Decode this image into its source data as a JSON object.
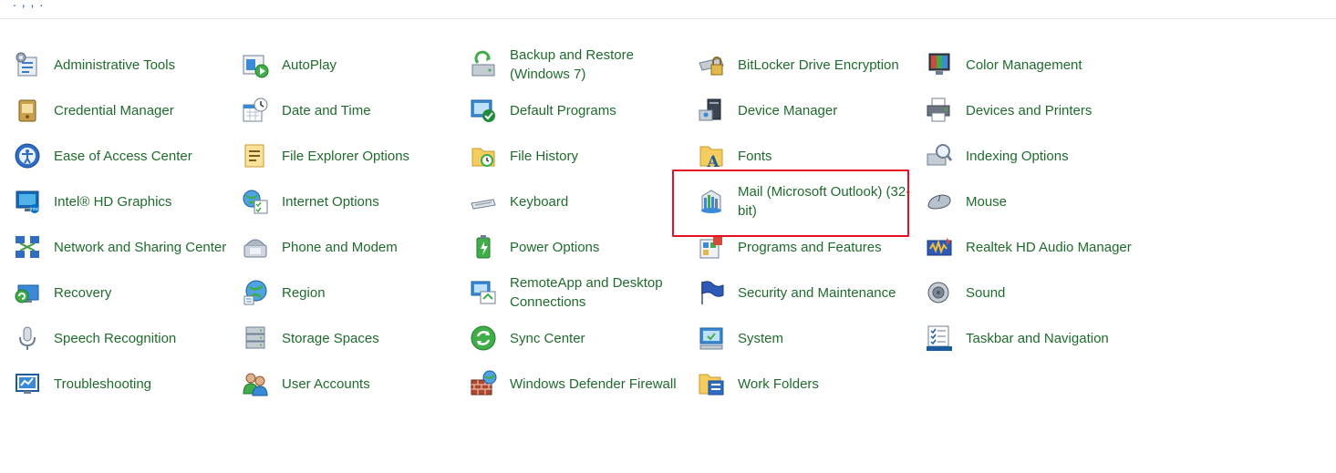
{
  "colors": {
    "link_green": "#1f6b2d",
    "highlight_red": "#e81123",
    "divider": "#e6e6e6"
  },
  "columns": [
    {
      "items": [
        {
          "label": "Administrative Tools",
          "icon": "admin-tools-icon"
        },
        {
          "label": "Credential Manager",
          "icon": "credential-manager-icon"
        },
        {
          "label": "Ease of Access Center",
          "icon": "ease-of-access-icon"
        },
        {
          "label": "Intel® HD Graphics",
          "icon": "intel-graphics-icon"
        },
        {
          "label": "Network and Sharing Center",
          "icon": "network-icon"
        },
        {
          "label": "Recovery",
          "icon": "recovery-icon"
        },
        {
          "label": "Speech Recognition",
          "icon": "microphone-icon"
        },
        {
          "label": "Troubleshooting",
          "icon": "troubleshooting-icon"
        }
      ]
    },
    {
      "items": [
        {
          "label": "AutoPlay",
          "icon": "autoplay-icon"
        },
        {
          "label": "Date and Time",
          "icon": "clock-calendar-icon"
        },
        {
          "label": "File Explorer Options",
          "icon": "folder-options-icon"
        },
        {
          "label": "Internet Options",
          "icon": "globe-checklist-icon"
        },
        {
          "label": "Phone and Modem",
          "icon": "phone-icon"
        },
        {
          "label": "Region",
          "icon": "region-globe-icon"
        },
        {
          "label": "Storage Spaces",
          "icon": "storage-icon"
        },
        {
          "label": "User Accounts",
          "icon": "users-icon"
        }
      ]
    },
    {
      "items": [
        {
          "label": "Backup and Restore (Windows 7)",
          "icon": "backup-icon"
        },
        {
          "label": "Default Programs",
          "icon": "default-programs-icon"
        },
        {
          "label": "File History",
          "icon": "file-history-icon"
        },
        {
          "label": "Keyboard",
          "icon": "keyboard-icon"
        },
        {
          "label": "Power Options",
          "icon": "power-icon"
        },
        {
          "label": "RemoteApp and Desktop Connections",
          "icon": "remote-desktop-icon"
        },
        {
          "label": "Sync Center",
          "icon": "sync-icon"
        },
        {
          "label": "Windows Defender Firewall",
          "icon": "firewall-icon"
        }
      ]
    },
    {
      "items": [
        {
          "label": "BitLocker Drive Encryption",
          "icon": "bitlocker-icon"
        },
        {
          "label": "Device Manager",
          "icon": "device-manager-icon"
        },
        {
          "label": "Fonts",
          "icon": "fonts-icon"
        },
        {
          "label": "Mail (Microsoft Outlook) (32-bit)",
          "icon": "mail-icon"
        },
        {
          "label": "Programs and Features",
          "icon": "programs-icon"
        },
        {
          "label": "Security and Maintenance",
          "icon": "flag-icon"
        },
        {
          "label": "System",
          "icon": "system-icon"
        },
        {
          "label": "Work Folders",
          "icon": "work-folders-icon"
        }
      ]
    },
    {
      "items": [
        {
          "label": "Color Management",
          "icon": "color-management-icon"
        },
        {
          "label": "Devices and Printers",
          "icon": "printer-icon"
        },
        {
          "label": "Indexing Options",
          "icon": "indexing-icon"
        },
        {
          "label": "Mouse",
          "icon": "mouse-icon"
        },
        {
          "label": "Realtek HD Audio Manager",
          "icon": "audio-manager-icon"
        },
        {
          "label": "Sound",
          "icon": "speaker-icon"
        },
        {
          "label": "Taskbar and Navigation",
          "icon": "taskbar-icon"
        }
      ]
    }
  ]
}
